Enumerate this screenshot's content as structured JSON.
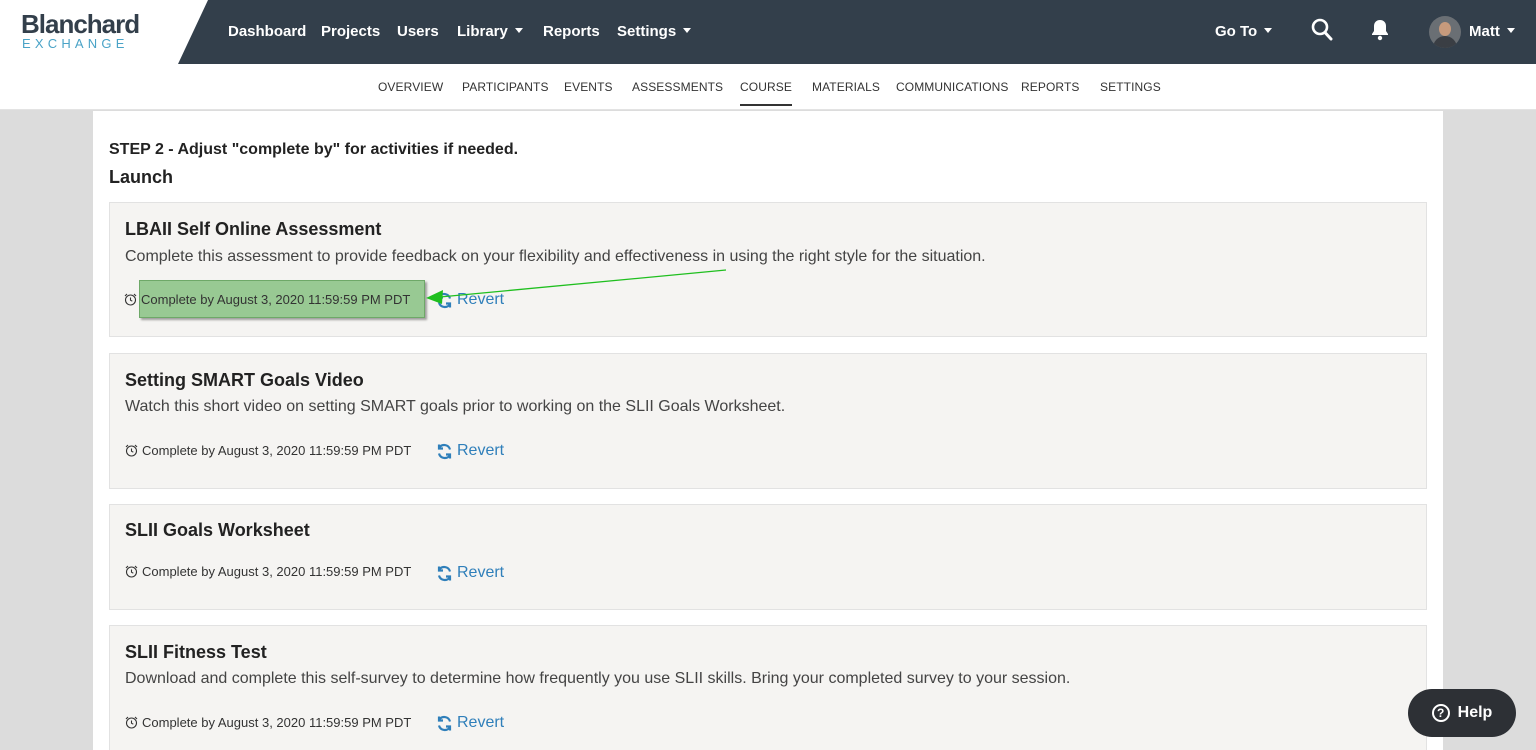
{
  "brand": {
    "name_top": "Blanchard",
    "name_bottom": "EXCHANGE"
  },
  "topnav": {
    "items": [
      {
        "label": "Dashboard"
      },
      {
        "label": "Projects"
      },
      {
        "label": "Users"
      },
      {
        "label": "Library"
      },
      {
        "label": "Reports"
      },
      {
        "label": "Settings"
      }
    ],
    "goto_label": "Go To",
    "user_name": "Matt"
  },
  "subnav": {
    "items": [
      {
        "label": "OVERVIEW"
      },
      {
        "label": "PARTICIPANTS"
      },
      {
        "label": "EVENTS"
      },
      {
        "label": "ASSESSMENTS"
      },
      {
        "label": "COURSE"
      },
      {
        "label": "MATERIALS"
      },
      {
        "label": "COMMUNICATIONS"
      },
      {
        "label": "REPORTS"
      },
      {
        "label": "SETTINGS"
      }
    ],
    "active": "COURSE"
  },
  "main": {
    "step_prefix": "STEP 2",
    "step_text": " - Adjust \"complete by\" for activities if needed.",
    "section_title": "Launch",
    "revert_label": "Revert",
    "activities": [
      {
        "title": "LBAII Self Online Assessment",
        "description": "Complete this assessment to provide feedback on your flexibility and effectiveness in using the right style for the situation.",
        "due": "Complete by August 3, 2020 11:59:59 PM PDT"
      },
      {
        "title": "Setting SMART Goals Video",
        "description": "Watch this short video on setting SMART goals prior to working on the SLII Goals Worksheet.",
        "due": "Complete by August 3, 2020 11:59:59 PM PDT"
      },
      {
        "title": "SLII Goals Worksheet",
        "description": "",
        "due": "Complete by August 3, 2020 11:59:59 PM PDT"
      },
      {
        "title": "SLII Fitness Test",
        "description": "Download and complete this self-survey to determine how frequently you use SLII skills. Bring your completed survey to your session.",
        "due": "Complete by August 3, 2020 11:59:59 PM PDT"
      }
    ]
  },
  "help": {
    "label": "Help"
  },
  "colors": {
    "topbar": "#333f4b",
    "accent": "#2f7fba",
    "highlight": "#98c993",
    "annotation_arrow": "#1fbf1f"
  }
}
